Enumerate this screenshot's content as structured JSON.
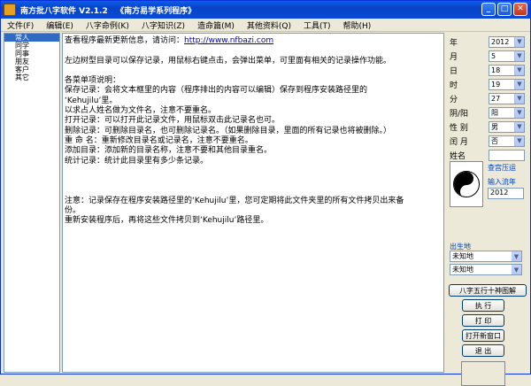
{
  "window": {
    "title": "南方批八字软件 V2.1.2   《南方易学系列程序》",
    "min": "_",
    "max": "□",
    "close": "✕"
  },
  "menu": [
    "文件(F)",
    "编辑(E)",
    "八字命例(K)",
    "八字知识(Z)",
    "造命篇(M)",
    "其他资料(Q)",
    "工具(T)",
    "帮助(H)"
  ],
  "list": [
    "常人",
    "同学",
    "同事",
    "朋友",
    "客户",
    "其它"
  ],
  "editor": {
    "lines": [
      {
        "t": "查看程序最新更新信息，请访问：",
        "link": "http://www.nfbazi.com"
      },
      {
        "t": ""
      },
      {
        "t": "左边树型目录可以保存记录，用鼠标右键点击，会弹出菜单，可里面有相关的记录操作功能。"
      },
      {
        "t": ""
      },
      {
        "t": "各菜单项说明："
      },
      {
        "t": "保存记录：会将文本框里的内容（程序排出的内容可以编辑）保存到程序安装路径里的"
      },
      {
        "t": "‘Kehujilu’里。"
      },
      {
        "t": "            以求占人姓名做为文件名，注意不要重名。"
      },
      {
        "t": "打开记录：可以打开此记录文件，用鼠标双击此记录名也可。"
      },
      {
        "t": "删除记录：可删除目录名，也可删除记录名。（如果删除目录，里面的所有记录也将被删除。）"
      },
      {
        "t": "重 命 名：重新修改目录名或记录名，注意不要重名。"
      },
      {
        "t": "添加目录：添加新的目录名称，注意不要和其他目录重名。"
      },
      {
        "t": "统计记录：统计此目录里有多少条记录。"
      },
      {
        "t": ""
      },
      {
        "t": ""
      },
      {
        "t": ""
      },
      {
        "t": "注意：记录保存在程序安装路径里的‘Kehujilu’里，您可定期将此文件夹里的所有文件拷贝出来备"
      },
      {
        "t": "份。"
      },
      {
        "t": "重新安装程序后，再将这些文件拷贝到‘Kehujilu’路径里。"
      }
    ]
  },
  "fields": [
    {
      "label": "年",
      "value": "2012"
    },
    {
      "label": "月",
      "value": "5"
    },
    {
      "label": "日",
      "value": "18"
    },
    {
      "label": "时",
      "value": "19"
    },
    {
      "label": "分",
      "value": "27"
    },
    {
      "label": "阴/阳",
      "value": "阳"
    },
    {
      "label": "性 别",
      "value": "男"
    },
    {
      "label": "闰 月",
      "value": "否"
    }
  ],
  "name_label": "姓名",
  "name_value": "",
  "qiyun": "查宫压运",
  "input_year_label": "输入流年",
  "input_year_value": "2012",
  "birthplace_label": "出生地",
  "birthplace": [
    "未知地",
    "未知地"
  ],
  "buttons": {
    "wuxing": "八字五行十神图解",
    "run": "执 行",
    "print": "打 印",
    "new_window": "打开新窗口",
    "exit": "退 出"
  }
}
